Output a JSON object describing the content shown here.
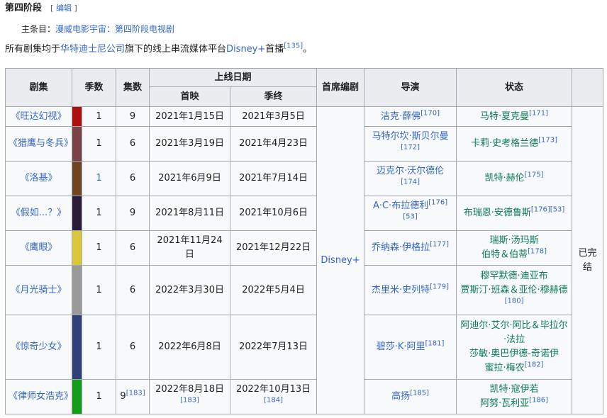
{
  "section": {
    "title": "第四阶段",
    "edit_open": "[",
    "edit_label": "编辑",
    "edit_close": "]"
  },
  "main_article": {
    "prefix": "主条目：",
    "link1": "漫威电影宇宙",
    "sep": "：",
    "link2": "第四阶段电视剧"
  },
  "intro": {
    "before": "所有剧集均于",
    "company": "华特迪士尼公司",
    "middle": "旗下的线上串流媒体平台",
    "platform": "Disney+",
    "after": "首播",
    "ref": "[135]",
    "end": "。"
  },
  "table": {
    "headers": {
      "series": "剧集",
      "season": "季数",
      "episodes": "集数",
      "release": "上线日期",
      "premiere": "首映",
      "finale": "季终",
      "network": "首席编剧",
      "director": "导演",
      "status": "状态"
    },
    "network": "Disney+",
    "status": "已完结",
    "rows": [
      {
        "title": "《旺达幻视》",
        "color": "#b10e0e",
        "season": "1",
        "episodes": "9",
        "ep_ref": "",
        "premiere": "2021年1月15日",
        "premiere_ref": "",
        "finale": "2021年3月5日",
        "finale_ref": "",
        "writer": "洁克·薛佛",
        "writer_ref": "[170]",
        "director": "马特·夏克曼",
        "director_ref": "[171]"
      },
      {
        "title": "《猎鹰与冬兵》",
        "color": "#7a4345",
        "season": "1",
        "episodes": "6",
        "ep_ref": "",
        "premiere": "2021年3月19日",
        "premiere_ref": "",
        "finale": "2021年4月23日",
        "finale_ref": "",
        "writer": "马特尔坎·斯贝尔曼",
        "writer_ref": "[172]",
        "director": "卡莉·史考格兰德",
        "director_ref": "[173]"
      },
      {
        "title": "《洛基》",
        "color": "#6e4422",
        "season": "1",
        "episodes": "6",
        "ep_ref": "",
        "premiere": "2021年6月9日",
        "premiere_ref": "",
        "finale": "2021年7月14日",
        "finale_ref": "",
        "writer": "迈克尔·沃尔德伦",
        "writer_ref": "[174]",
        "director": "凯特·赫伦",
        "director_ref": "[175]"
      },
      {
        "title": "《假如...？》",
        "color": "#2b1a38",
        "season": "1",
        "episodes": "9",
        "ep_ref": "",
        "premiere": "2021年8月11日",
        "premiere_ref": "",
        "finale": "2021年10月6日",
        "finale_ref": "",
        "writer": "A·C·布拉德利",
        "writer_ref": "[176][53]",
        "director": "布瑞恩·安德鲁斯",
        "director_ref": "[176][53]"
      },
      {
        "title": "《鹰眼》",
        "color": "#d9c63a",
        "season": "1",
        "episodes": "6",
        "ep_ref": "",
        "premiere": "2021年11月24日",
        "premiere_ref": "",
        "finale": "2021年12月22日",
        "finale_ref": "",
        "writer": "乔纳森·伊格拉",
        "writer_ref": "[177]",
        "director": "瑞斯·汤玛斯\n伯特＆伯蒂",
        "director_ref": "[178]"
      },
      {
        "title": "《月光骑士》",
        "color": "#9a9a9a",
        "season": "1",
        "episodes": "6",
        "ep_ref": "",
        "premiere": "2022年3月30日",
        "premiere_ref": "",
        "finale": "2022年5月4日",
        "finale_ref": "",
        "writer": "杰里米·史列特",
        "writer_ref": "[179]",
        "director": "穆罕默德·迪亚布\n贾斯汀·班森＆亚伦·穆赫德",
        "director_ref": "[180]"
      },
      {
        "title": "《惊奇少女》",
        "color": "#2f3f7a",
        "season": "1",
        "episodes": "6",
        "ep_ref": "",
        "premiere": "2022年6月8日",
        "premiere_ref": "",
        "finale": "2022年7月13日",
        "finale_ref": "",
        "writer": "碧莎·K·阿里",
        "writer_ref": "[181]",
        "director": "阿迪尔·艾尔·阿比＆毕拉尔·法拉\n莎敏·奥巴伊德-奇诺伊\n蜜拉·梅农",
        "director_ref": "[182]"
      },
      {
        "title": "《律师女浩克》",
        "color": "#119c1a",
        "season": "1",
        "episodes": "9",
        "ep_ref": "[183]",
        "premiere": "2022年8月18日",
        "premiere_ref": "[183]",
        "finale": "2022年10月13日",
        "finale_ref": "[184]",
        "writer": "高扬",
        "writer_ref": "[185]",
        "director": "凯特·寇伊若\n阿努·瓦利亚",
        "director_ref": "[186]"
      }
    ]
  }
}
